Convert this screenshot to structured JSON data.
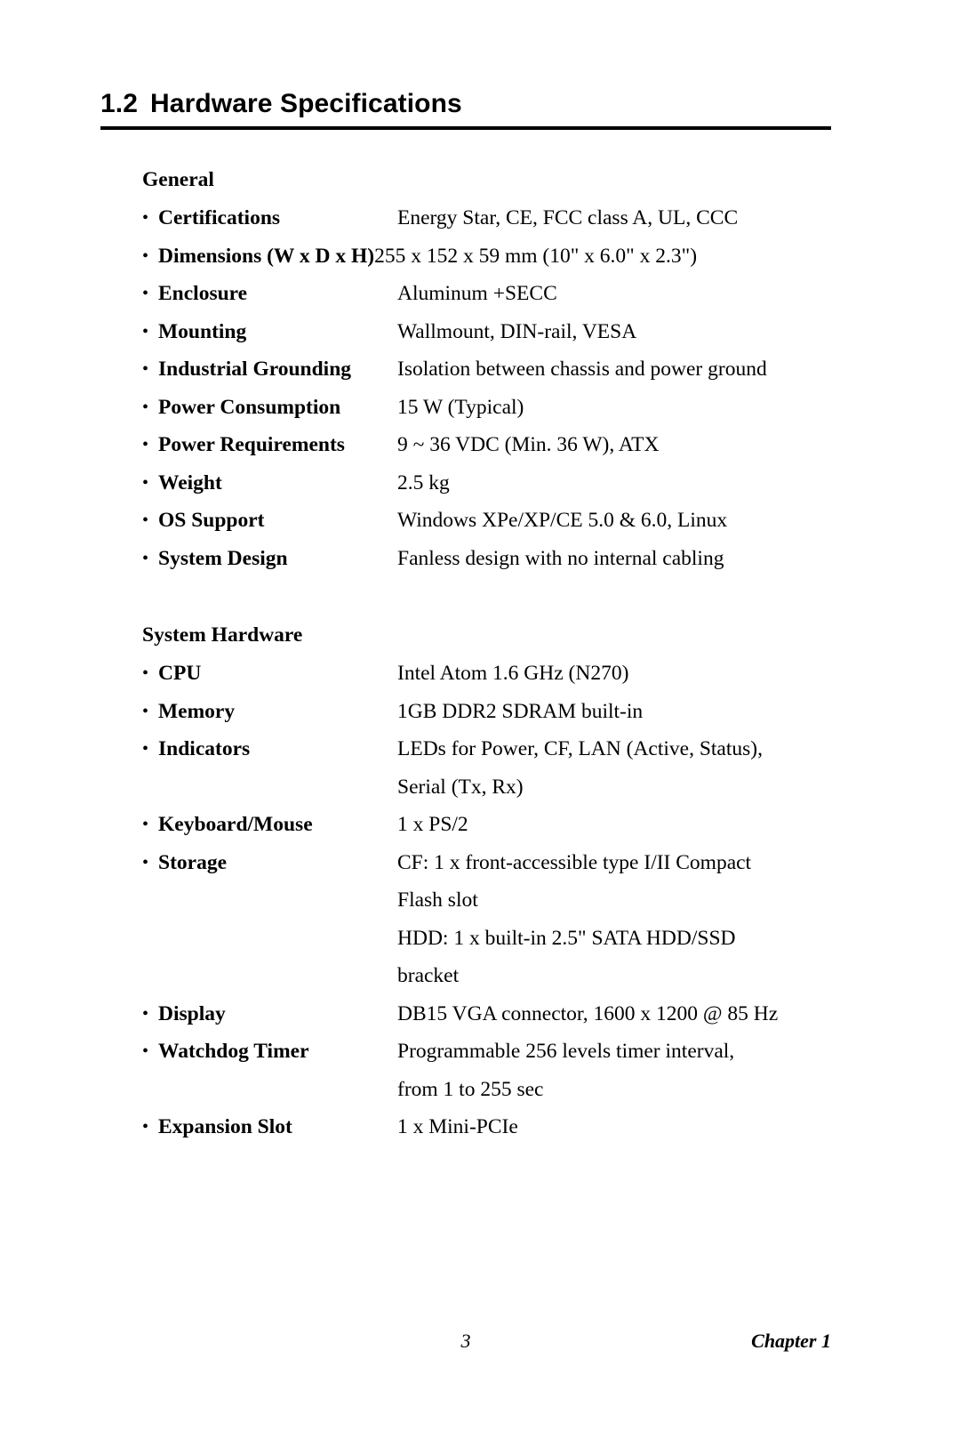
{
  "heading": {
    "number": "1.2",
    "title": "Hardware Specifications"
  },
  "sections": [
    {
      "title": "General",
      "rows": [
        {
          "bullet": "•",
          "label": "Certifications",
          "overflow": false,
          "lines": [
            "Energy Star, CE, FCC class A, UL, CCC"
          ]
        },
        {
          "bullet": "•",
          "label": "Dimensions (W x D x H)",
          "overflow": true,
          "lines": [
            "255 x 152 x 59 mm (10\" x 6.0\" x 2.3\")"
          ]
        },
        {
          "bullet": "•",
          "label": "Enclosure",
          "overflow": false,
          "lines": [
            "Aluminum +SECC"
          ]
        },
        {
          "bullet": "•",
          "label": "Mounting",
          "overflow": false,
          "lines": [
            "Wallmount, DIN-rail, VESA"
          ]
        },
        {
          "bullet": "•",
          "label": "Industrial Grounding",
          "overflow": false,
          "lines": [
            "Isolation between chassis and power ground"
          ]
        },
        {
          "bullet": "•",
          "label": "Power Consumption",
          "overflow": false,
          "lines": [
            "15 W (Typical)"
          ]
        },
        {
          "bullet": "•",
          "label": "Power Requirements",
          "overflow": false,
          "lines": [
            "9 ~ 36 VDC (Min. 36 W), ATX"
          ]
        },
        {
          "bullet": "•",
          "label": "Weight",
          "overflow": false,
          "lines": [
            "2.5 kg"
          ]
        },
        {
          "bullet": "•",
          "label": "OS Support",
          "overflow": false,
          "lines": [
            "Windows XPe/XP/CE 5.0 & 6.0, Linux"
          ]
        },
        {
          "bullet": "•",
          "label": "System Design",
          "overflow": false,
          "lines": [
            "Fanless design with no internal cabling"
          ]
        }
      ]
    },
    {
      "title": "System Hardware",
      "rows": [
        {
          "bullet": "•",
          "label": "CPU",
          "overflow": false,
          "lines": [
            "Intel Atom 1.6 GHz (N270)"
          ]
        },
        {
          "bullet": "•",
          "label": "Memory",
          "overflow": false,
          "lines": [
            "1GB DDR2 SDRAM built-in"
          ]
        },
        {
          "bullet": "•",
          "label": "Indicators",
          "overflow": false,
          "lines": [
            "LEDs for Power, CF, LAN (Active, Status),",
            "Serial (Tx, Rx)"
          ]
        },
        {
          "bullet": "•",
          "label": "Keyboard/Mouse",
          "overflow": false,
          "lines": [
            "1 x PS/2"
          ]
        },
        {
          "bullet": "•",
          "label": "Storage",
          "overflow": false,
          "lines": [
            "CF: 1 x front-accessible type I/II Compact",
            "Flash slot",
            "HDD: 1 x built-in 2.5\" SATA HDD/SSD",
            "bracket"
          ]
        },
        {
          "bullet": "•",
          "label": "Display",
          "overflow": false,
          "lines": [
            "DB15 VGA connector, 1600 x 1200 @ 85 Hz"
          ]
        },
        {
          "bullet": "•",
          "label": "Watchdog Timer",
          "overflow": false,
          "lines": [
            "Programmable 256 levels timer interval,",
            "from 1 to 255 sec"
          ]
        },
        {
          "bullet": "•",
          "label": "Expansion Slot",
          "overflow": false,
          "lines": [
            "1 x Mini-PCIe"
          ]
        }
      ]
    }
  ],
  "footer": {
    "page_number": "3",
    "chapter": "Chapter 1"
  }
}
